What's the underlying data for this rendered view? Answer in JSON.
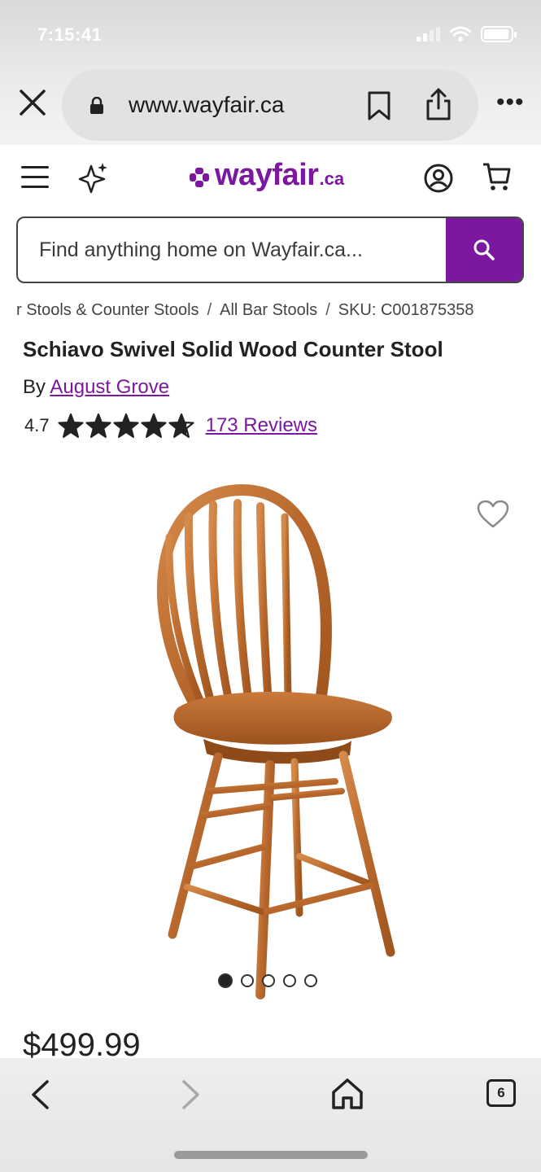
{
  "status_bar": {
    "time": "7:15:41"
  },
  "browser": {
    "url": "www.wayfair.ca",
    "tab_count": "6"
  },
  "site": {
    "logo_text": "wayfair",
    "logo_suffix": ".ca",
    "brand_color": "#7b189f"
  },
  "search": {
    "placeholder": "Find anything home on Wayfair.ca..."
  },
  "breadcrumb": {
    "items": [
      "r Stools & Counter Stools",
      "All Bar Stools",
      "SKU: C001875358"
    ]
  },
  "product": {
    "title": "Schiavo Swivel Solid Wood Counter Stool",
    "by_label": "By",
    "brand": "August Grove",
    "rating": "4.7",
    "rating_value": 4.7,
    "reviews": "173 Reviews",
    "price": "$499.99",
    "image_count": 5,
    "active_image_index": 0
  },
  "icons": [
    "close-icon",
    "lock-icon",
    "bookmark-icon",
    "share-icon",
    "more-icon",
    "menu-icon",
    "sparkle-icon",
    "account-icon",
    "cart-icon",
    "search-icon",
    "heart-icon",
    "back-icon",
    "forward-icon",
    "home-icon",
    "tabs-icon"
  ]
}
